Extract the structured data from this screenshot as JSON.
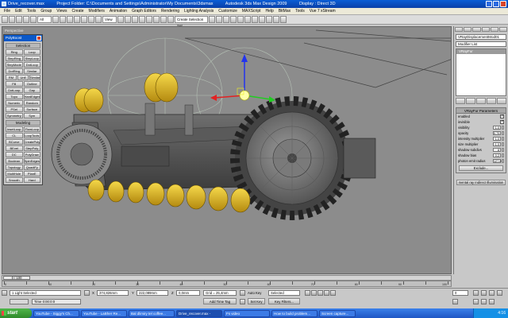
{
  "window": {
    "title_file": "Drive_recover.max",
    "title_project": "Project Folder: C:\\Documents and Settings\\Administrator\\My Documents\\3dsmax",
    "title_app": "Autodesk 3ds Max Design 2009",
    "title_display": "Display : Direct 3D"
  },
  "menu": [
    "File",
    "Edit",
    "Tools",
    "Group",
    "Views",
    "Create",
    "Modifiers",
    "Animation",
    "Graph Editors",
    "Rendering",
    "Lighting Analysis",
    "Customize",
    "MAXScript",
    "Help",
    "BitMax",
    "Tools",
    "Vue 7 xStream"
  ],
  "toolbar": {
    "filter": "All",
    "coord": "View",
    "selection_set": "Create Selection Set"
  },
  "viewport": {
    "label": "Perspective"
  },
  "graphite_panel": {
    "title": "PolyBoost",
    "sections": [
      {
        "name": "Selection",
        "rows": [
          [
            "Ring",
            "Loop"
          ],
          [
            "StepRing",
            "StepLoop"
          ],
          [
            "StepMode",
            "DotLoop"
          ],
          [
            "DotRing",
            "Similar"
          ],
          [
            "RM",
            "Unfl",
            "Similar"
          ],
          [
            "Fill",
            "Outline"
          ],
          [
            "DotLoop",
            "Gap"
          ],
          [
            "Topo",
            "HardEdges"
          ],
          [
            "Numeric",
            "Random"
          ],
          [
            "PSel",
            "Surface"
          ],
          [
            "Symmetry",
            "Sym"
          ]
        ]
      },
      {
        "name": "Modeling",
        "rows": [
          [
            "InsetLoop",
            "FlowLoop"
          ],
          [
            "CL",
            "LoopTools"
          ],
          [
            "BCurve",
            "CreatePoly"
          ],
          [
            "BEvel",
            "StepPoly"
          ],
          [
            "DC",
            "PolyDraw"
          ],
          [
            "Boolean",
            "SpinEdges"
          ],
          [
            "Topology",
            "QuadiFy"
          ],
          [
            "MultiHole",
            "PlanE"
          ],
          [
            "Smooth",
            "Hard"
          ]
        ]
      }
    ]
  },
  "command_panel": {
    "object_name": "VRayDisplacementMod01",
    "modifier_list": "Modifier List",
    "stack_item": "VRayFur",
    "rollout_title": "VRayFur Parameters",
    "params": [
      {
        "label": "enabled",
        "type": "check",
        "value": "✓"
      },
      {
        "label": "invisible",
        "type": "check",
        "value": "✓"
      },
      {
        "label": "visibility",
        "type": "spin",
        "value": "1.0"
      },
      {
        "label": "opacity",
        "type": "spin",
        "value": "0.75"
      },
      {
        "label": "intensity multiplier",
        "type": "spin",
        "value": "1.0"
      },
      {
        "label": "size multiplier",
        "type": "spin",
        "value": "1.0"
      },
      {
        "label": "shadow subdivs",
        "type": "spin",
        "value": "8"
      },
      {
        "label": "shadow bias",
        "type": "spin",
        "value": "0.2"
      },
      {
        "label": "photon emit radius",
        "type": "spin",
        "value": "127.0"
      }
    ],
    "exclude_button": "Exclude...",
    "bottom_button": "mental ray Indirect Illumination"
  },
  "timeline": {
    "slider_label": "0 / 100",
    "ticks": [
      "0",
      "10",
      "20",
      "30",
      "40",
      "50",
      "60",
      "70",
      "80",
      "90",
      "100"
    ]
  },
  "status": {
    "selection": "1 Light Selected",
    "prompt": "Time 0:00:0:0",
    "x_label": "X",
    "x_value": "374,826mm",
    "y_label": "Y",
    "y_value": "222,089mm",
    "z_label": "Z",
    "z_value": "0,0mm",
    "grid": "Grid = 25,4mm",
    "add_time_tag": "Add Time Tag",
    "auto_key": "Auto Key",
    "set_key": "Set Key",
    "selected": "Selected",
    "key_filters": "Key Filters...",
    "frame": "0"
  },
  "taskbar": {
    "start": "start",
    "tasks": [
      "YouTube - Siggy's Ch...",
      "YouTube - LaBher Re...",
      "Bal dlimiry tel coffee...",
      "Drive_recover.max -",
      "Fs video",
      "How to build problem...",
      "Screen capture..."
    ],
    "time": "4:16"
  },
  "colors": {
    "viewport_bg": "#8c8c8c",
    "title_blue": "#0a4fc0",
    "gear_yellow": "#e8c020",
    "gizmo_x": "#e22222",
    "gizmo_y": "#22cc22",
    "gizmo_z": "#2233ee"
  }
}
